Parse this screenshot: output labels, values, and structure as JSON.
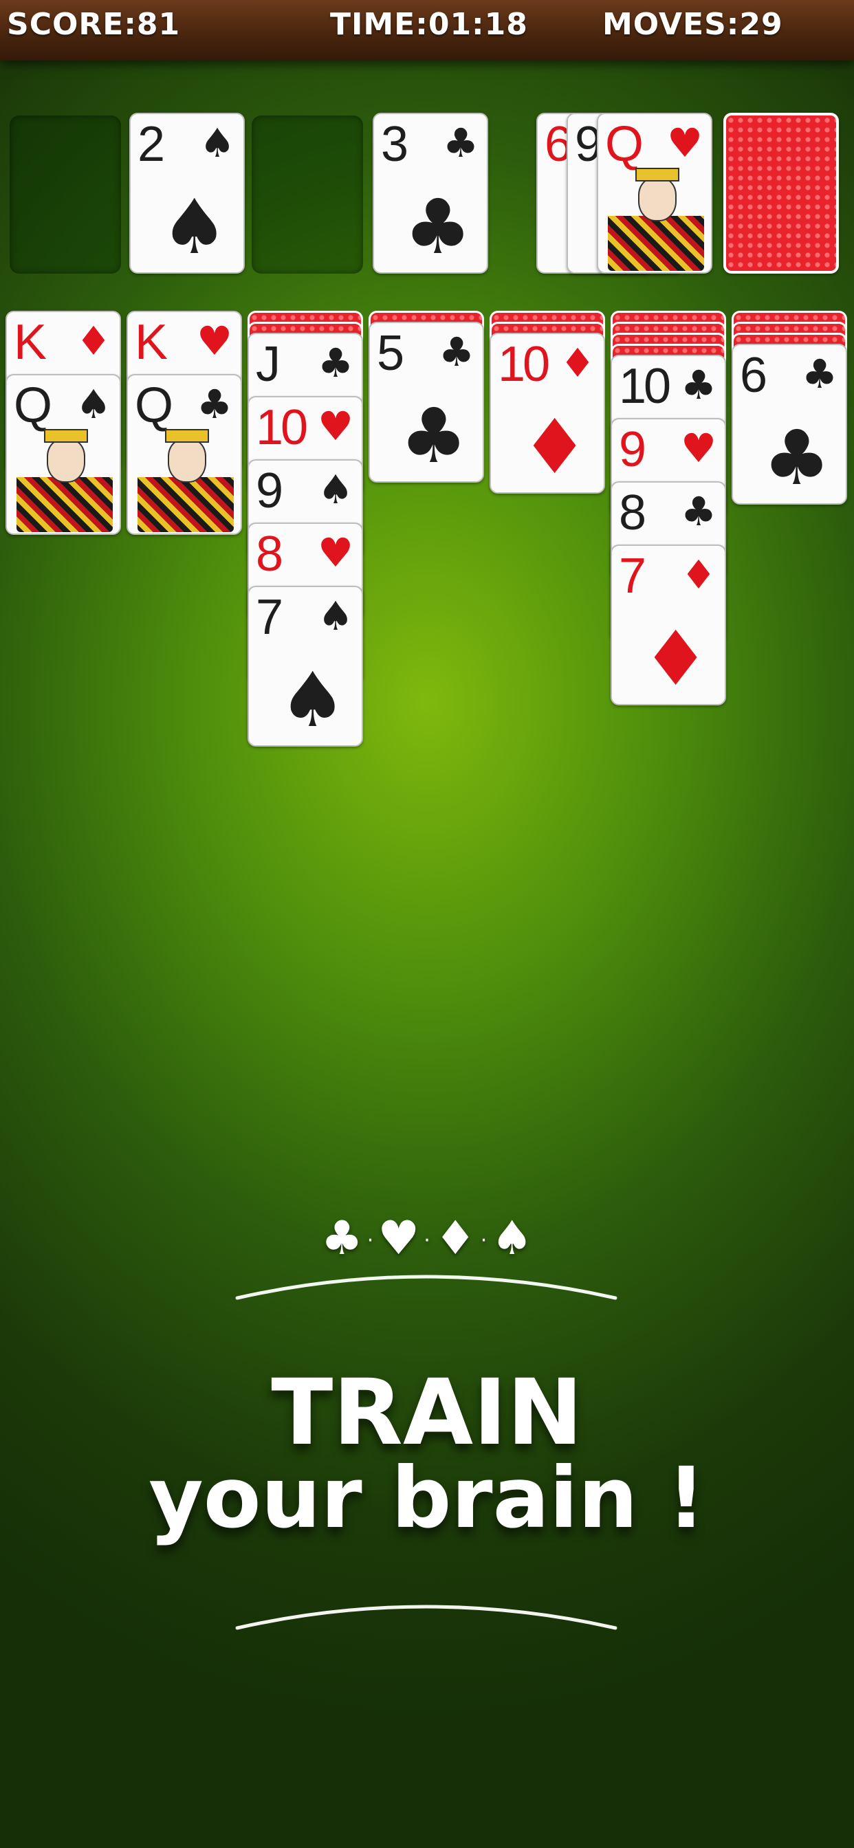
{
  "header": {
    "score_label": "SCORE:",
    "score_value": "81",
    "time_label": "TIME:",
    "time_value": "01:18",
    "moves_label": "MOVES:",
    "moves_value": "29"
  },
  "foundations": [
    {
      "rank": "",
      "suit": "",
      "empty": true
    },
    {
      "rank": "2",
      "suit": "♠",
      "color": "black"
    },
    {
      "rank": "",
      "suit": "",
      "empty": true
    },
    {
      "rank": "3",
      "suit": "♣",
      "color": "black"
    }
  ],
  "waste": {
    "ranks_behind": [
      "6",
      "9"
    ],
    "top": {
      "rank": "Q",
      "suit": "♥",
      "color": "red"
    }
  },
  "stock": {
    "state": "face-down"
  },
  "tableau": [
    {
      "hidden": 0,
      "cards": [
        {
          "rank": "K",
          "suit": "♦",
          "color": "red"
        },
        {
          "rank": "Q",
          "suit": "♠",
          "color": "black"
        }
      ]
    },
    {
      "hidden": 0,
      "cards": [
        {
          "rank": "K",
          "suit": "♥",
          "color": "red"
        },
        {
          "rank": "Q",
          "suit": "♣",
          "color": "black"
        }
      ]
    },
    {
      "hidden": 2,
      "cards": [
        {
          "rank": "J",
          "suit": "♣",
          "color": "black"
        },
        {
          "rank": "10",
          "suit": "♥",
          "color": "red"
        },
        {
          "rank": "9",
          "suit": "♠",
          "color": "black"
        },
        {
          "rank": "8",
          "suit": "♥",
          "color": "red"
        },
        {
          "rank": "7",
          "suit": "♠",
          "color": "black"
        }
      ]
    },
    {
      "hidden": 1,
      "cards": [
        {
          "rank": "5",
          "suit": "♣",
          "color": "black"
        }
      ]
    },
    {
      "hidden": 2,
      "cards": [
        {
          "rank": "10",
          "suit": "♦",
          "color": "red"
        }
      ]
    },
    {
      "hidden": 4,
      "cards": [
        {
          "rank": "10",
          "suit": "♣",
          "color": "black"
        },
        {
          "rank": "9",
          "suit": "♥",
          "color": "red"
        },
        {
          "rank": "8",
          "suit": "♣",
          "color": "black"
        },
        {
          "rank": "7",
          "suit": "♦",
          "color": "red"
        }
      ]
    },
    {
      "hidden": 3,
      "cards": [
        {
          "rank": "6",
          "suit": "♣",
          "color": "black"
        }
      ]
    }
  ],
  "banner": {
    "suits": [
      "♣",
      "♥",
      "♦",
      "♠"
    ],
    "line1": "TRAIN",
    "line2": "your brain !"
  },
  "colors": {
    "table_center": "#7fb80d",
    "table_edge": "#162f07",
    "card_red": "#e0141c",
    "card_black": "#1e1e1e",
    "card_back": "#e8232b"
  }
}
